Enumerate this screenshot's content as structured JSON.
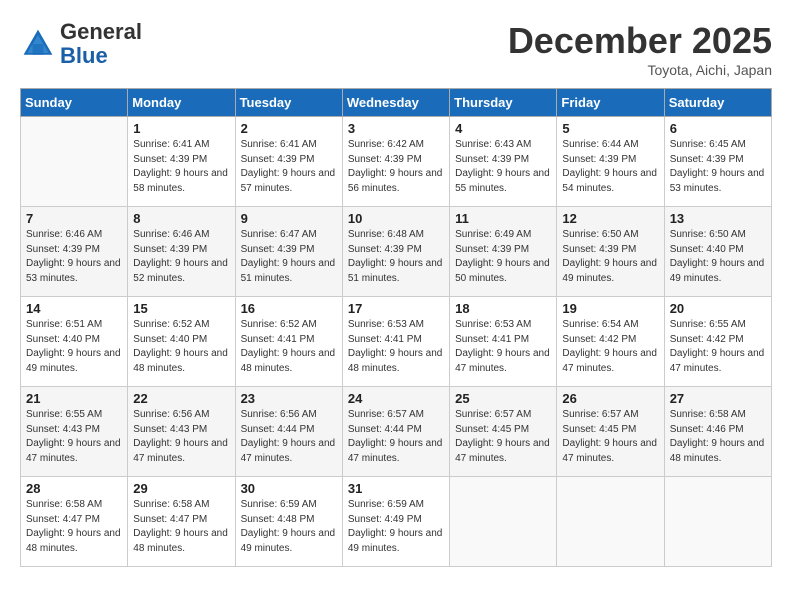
{
  "header": {
    "logo_line1": "General",
    "logo_line2": "Blue",
    "month_title": "December 2025",
    "subtitle": "Toyota, Aichi, Japan"
  },
  "weekdays": [
    "Sunday",
    "Monday",
    "Tuesday",
    "Wednesday",
    "Thursday",
    "Friday",
    "Saturday"
  ],
  "weeks": [
    [
      {
        "day": "",
        "sunrise": "",
        "sunset": "",
        "daylight": ""
      },
      {
        "day": "1",
        "sunrise": "Sunrise: 6:41 AM",
        "sunset": "Sunset: 4:39 PM",
        "daylight": "Daylight: 9 hours and 58 minutes."
      },
      {
        "day": "2",
        "sunrise": "Sunrise: 6:41 AM",
        "sunset": "Sunset: 4:39 PM",
        "daylight": "Daylight: 9 hours and 57 minutes."
      },
      {
        "day": "3",
        "sunrise": "Sunrise: 6:42 AM",
        "sunset": "Sunset: 4:39 PM",
        "daylight": "Daylight: 9 hours and 56 minutes."
      },
      {
        "day": "4",
        "sunrise": "Sunrise: 6:43 AM",
        "sunset": "Sunset: 4:39 PM",
        "daylight": "Daylight: 9 hours and 55 minutes."
      },
      {
        "day": "5",
        "sunrise": "Sunrise: 6:44 AM",
        "sunset": "Sunset: 4:39 PM",
        "daylight": "Daylight: 9 hours and 54 minutes."
      },
      {
        "day": "6",
        "sunrise": "Sunrise: 6:45 AM",
        "sunset": "Sunset: 4:39 PM",
        "daylight": "Daylight: 9 hours and 53 minutes."
      }
    ],
    [
      {
        "day": "7",
        "sunrise": "Sunrise: 6:46 AM",
        "sunset": "Sunset: 4:39 PM",
        "daylight": "Daylight: 9 hours and 53 minutes."
      },
      {
        "day": "8",
        "sunrise": "Sunrise: 6:46 AM",
        "sunset": "Sunset: 4:39 PM",
        "daylight": "Daylight: 9 hours and 52 minutes."
      },
      {
        "day": "9",
        "sunrise": "Sunrise: 6:47 AM",
        "sunset": "Sunset: 4:39 PM",
        "daylight": "Daylight: 9 hours and 51 minutes."
      },
      {
        "day": "10",
        "sunrise": "Sunrise: 6:48 AM",
        "sunset": "Sunset: 4:39 PM",
        "daylight": "Daylight: 9 hours and 51 minutes."
      },
      {
        "day": "11",
        "sunrise": "Sunrise: 6:49 AM",
        "sunset": "Sunset: 4:39 PM",
        "daylight": "Daylight: 9 hours and 50 minutes."
      },
      {
        "day": "12",
        "sunrise": "Sunrise: 6:50 AM",
        "sunset": "Sunset: 4:39 PM",
        "daylight": "Daylight: 9 hours and 49 minutes."
      },
      {
        "day": "13",
        "sunrise": "Sunrise: 6:50 AM",
        "sunset": "Sunset: 4:40 PM",
        "daylight": "Daylight: 9 hours and 49 minutes."
      }
    ],
    [
      {
        "day": "14",
        "sunrise": "Sunrise: 6:51 AM",
        "sunset": "Sunset: 4:40 PM",
        "daylight": "Daylight: 9 hours and 49 minutes."
      },
      {
        "day": "15",
        "sunrise": "Sunrise: 6:52 AM",
        "sunset": "Sunset: 4:40 PM",
        "daylight": "Daylight: 9 hours and 48 minutes."
      },
      {
        "day": "16",
        "sunrise": "Sunrise: 6:52 AM",
        "sunset": "Sunset: 4:41 PM",
        "daylight": "Daylight: 9 hours and 48 minutes."
      },
      {
        "day": "17",
        "sunrise": "Sunrise: 6:53 AM",
        "sunset": "Sunset: 4:41 PM",
        "daylight": "Daylight: 9 hours and 48 minutes."
      },
      {
        "day": "18",
        "sunrise": "Sunrise: 6:53 AM",
        "sunset": "Sunset: 4:41 PM",
        "daylight": "Daylight: 9 hours and 47 minutes."
      },
      {
        "day": "19",
        "sunrise": "Sunrise: 6:54 AM",
        "sunset": "Sunset: 4:42 PM",
        "daylight": "Daylight: 9 hours and 47 minutes."
      },
      {
        "day": "20",
        "sunrise": "Sunrise: 6:55 AM",
        "sunset": "Sunset: 4:42 PM",
        "daylight": "Daylight: 9 hours and 47 minutes."
      }
    ],
    [
      {
        "day": "21",
        "sunrise": "Sunrise: 6:55 AM",
        "sunset": "Sunset: 4:43 PM",
        "daylight": "Daylight: 9 hours and 47 minutes."
      },
      {
        "day": "22",
        "sunrise": "Sunrise: 6:56 AM",
        "sunset": "Sunset: 4:43 PM",
        "daylight": "Daylight: 9 hours and 47 minutes."
      },
      {
        "day": "23",
        "sunrise": "Sunrise: 6:56 AM",
        "sunset": "Sunset: 4:44 PM",
        "daylight": "Daylight: 9 hours and 47 minutes."
      },
      {
        "day": "24",
        "sunrise": "Sunrise: 6:57 AM",
        "sunset": "Sunset: 4:44 PM",
        "daylight": "Daylight: 9 hours and 47 minutes."
      },
      {
        "day": "25",
        "sunrise": "Sunrise: 6:57 AM",
        "sunset": "Sunset: 4:45 PM",
        "daylight": "Daylight: 9 hours and 47 minutes."
      },
      {
        "day": "26",
        "sunrise": "Sunrise: 6:57 AM",
        "sunset": "Sunset: 4:45 PM",
        "daylight": "Daylight: 9 hours and 47 minutes."
      },
      {
        "day": "27",
        "sunrise": "Sunrise: 6:58 AM",
        "sunset": "Sunset: 4:46 PM",
        "daylight": "Daylight: 9 hours and 48 minutes."
      }
    ],
    [
      {
        "day": "28",
        "sunrise": "Sunrise: 6:58 AM",
        "sunset": "Sunset: 4:47 PM",
        "daylight": "Daylight: 9 hours and 48 minutes."
      },
      {
        "day": "29",
        "sunrise": "Sunrise: 6:58 AM",
        "sunset": "Sunset: 4:47 PM",
        "daylight": "Daylight: 9 hours and 48 minutes."
      },
      {
        "day": "30",
        "sunrise": "Sunrise: 6:59 AM",
        "sunset": "Sunset: 4:48 PM",
        "daylight": "Daylight: 9 hours and 49 minutes."
      },
      {
        "day": "31",
        "sunrise": "Sunrise: 6:59 AM",
        "sunset": "Sunset: 4:49 PM",
        "daylight": "Daylight: 9 hours and 49 minutes."
      },
      {
        "day": "",
        "sunrise": "",
        "sunset": "",
        "daylight": ""
      },
      {
        "day": "",
        "sunrise": "",
        "sunset": "",
        "daylight": ""
      },
      {
        "day": "",
        "sunrise": "",
        "sunset": "",
        "daylight": ""
      }
    ]
  ]
}
